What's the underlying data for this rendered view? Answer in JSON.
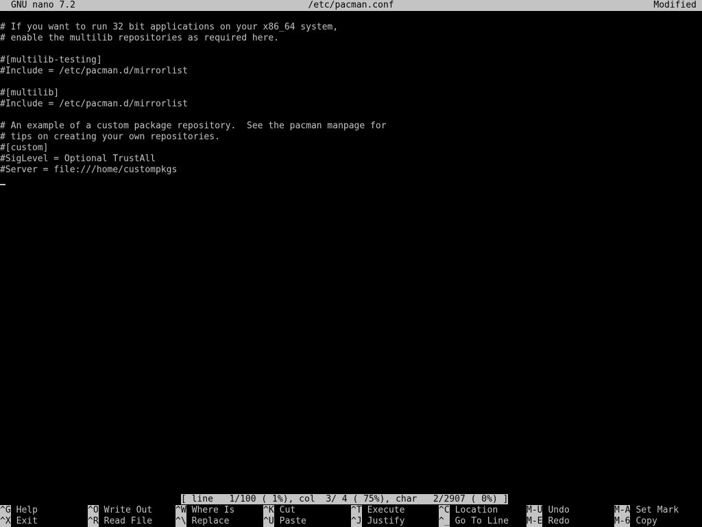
{
  "titlebar": {
    "version": "GNU nano 7.2",
    "filename": "/etc/pacman.conf",
    "status": "Modified"
  },
  "editor": {
    "lines": [
      "# If you want to run 32 bit applications on your x86_64 system,",
      "# enable the multilib repositories as required here.",
      "",
      "#[multilib-testing]",
      "#Include = /etc/pacman.d/mirrorlist",
      "",
      "#[multilib]",
      "#Include = /etc/pacman.d/mirrorlist",
      "",
      "# An example of a custom package repository.  See the pacman manpage for",
      "# tips on creating your own repositories.",
      "#[custom]",
      "#SigLevel = Optional TrustAll",
      "#Server = file:///home/custompkgs"
    ]
  },
  "status_bar": "[ line   1/100 ( 1%), col  3/ 4 ( 75%), char   2/2907 ( 0%) ]",
  "shortcuts": {
    "row1": [
      {
        "key": "^G",
        "label": "Help"
      },
      {
        "key": "^O",
        "label": "Write Out"
      },
      {
        "key": "^W",
        "label": "Where Is"
      },
      {
        "key": "^K",
        "label": "Cut"
      },
      {
        "key": "^T",
        "label": "Execute"
      },
      {
        "key": "^C",
        "label": "Location"
      },
      {
        "key": "M-U",
        "label": "Undo"
      },
      {
        "key": "M-A",
        "label": "Set Mark"
      }
    ],
    "row2": [
      {
        "key": "^X",
        "label": "Exit"
      },
      {
        "key": "^R",
        "label": "Read File"
      },
      {
        "key": "^\\",
        "label": "Replace"
      },
      {
        "key": "^U",
        "label": "Paste"
      },
      {
        "key": "^J",
        "label": "Justify"
      },
      {
        "key": "^_",
        "label": "Go To Line"
      },
      {
        "key": "M-E",
        "label": "Redo"
      },
      {
        "key": "M-6",
        "label": "Copy"
      }
    ]
  },
  "colors": {
    "foreground": "#c4c4c4",
    "background": "#000000"
  }
}
